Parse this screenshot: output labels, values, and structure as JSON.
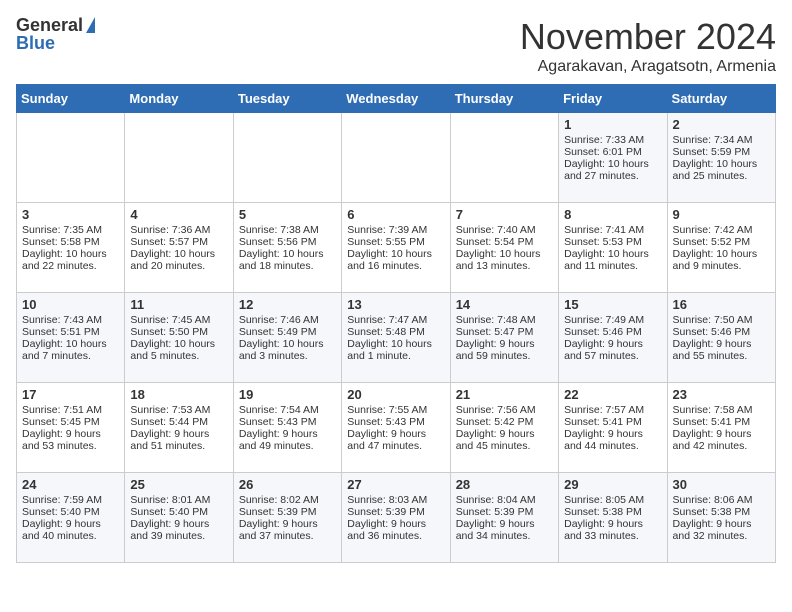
{
  "logo": {
    "line1": "General",
    "line2": "Blue"
  },
  "title": "November 2024",
  "subtitle": "Agarakavan, Aragatsotn, Armenia",
  "headers": [
    "Sunday",
    "Monday",
    "Tuesday",
    "Wednesday",
    "Thursday",
    "Friday",
    "Saturday"
  ],
  "weeks": [
    [
      {
        "day": "",
        "info": ""
      },
      {
        "day": "",
        "info": ""
      },
      {
        "day": "",
        "info": ""
      },
      {
        "day": "",
        "info": ""
      },
      {
        "day": "",
        "info": ""
      },
      {
        "day": "1",
        "info": "Sunrise: 7:33 AM\nSunset: 6:01 PM\nDaylight: 10 hours and 27 minutes."
      },
      {
        "day": "2",
        "info": "Sunrise: 7:34 AM\nSunset: 5:59 PM\nDaylight: 10 hours and 25 minutes."
      }
    ],
    [
      {
        "day": "3",
        "info": "Sunrise: 7:35 AM\nSunset: 5:58 PM\nDaylight: 10 hours and 22 minutes."
      },
      {
        "day": "4",
        "info": "Sunrise: 7:36 AM\nSunset: 5:57 PM\nDaylight: 10 hours and 20 minutes."
      },
      {
        "day": "5",
        "info": "Sunrise: 7:38 AM\nSunset: 5:56 PM\nDaylight: 10 hours and 18 minutes."
      },
      {
        "day": "6",
        "info": "Sunrise: 7:39 AM\nSunset: 5:55 PM\nDaylight: 10 hours and 16 minutes."
      },
      {
        "day": "7",
        "info": "Sunrise: 7:40 AM\nSunset: 5:54 PM\nDaylight: 10 hours and 13 minutes."
      },
      {
        "day": "8",
        "info": "Sunrise: 7:41 AM\nSunset: 5:53 PM\nDaylight: 10 hours and 11 minutes."
      },
      {
        "day": "9",
        "info": "Sunrise: 7:42 AM\nSunset: 5:52 PM\nDaylight: 10 hours and 9 minutes."
      }
    ],
    [
      {
        "day": "10",
        "info": "Sunrise: 7:43 AM\nSunset: 5:51 PM\nDaylight: 10 hours and 7 minutes."
      },
      {
        "day": "11",
        "info": "Sunrise: 7:45 AM\nSunset: 5:50 PM\nDaylight: 10 hours and 5 minutes."
      },
      {
        "day": "12",
        "info": "Sunrise: 7:46 AM\nSunset: 5:49 PM\nDaylight: 10 hours and 3 minutes."
      },
      {
        "day": "13",
        "info": "Sunrise: 7:47 AM\nSunset: 5:48 PM\nDaylight: 10 hours and 1 minute."
      },
      {
        "day": "14",
        "info": "Sunrise: 7:48 AM\nSunset: 5:47 PM\nDaylight: 9 hours and 59 minutes."
      },
      {
        "day": "15",
        "info": "Sunrise: 7:49 AM\nSunset: 5:46 PM\nDaylight: 9 hours and 57 minutes."
      },
      {
        "day": "16",
        "info": "Sunrise: 7:50 AM\nSunset: 5:46 PM\nDaylight: 9 hours and 55 minutes."
      }
    ],
    [
      {
        "day": "17",
        "info": "Sunrise: 7:51 AM\nSunset: 5:45 PM\nDaylight: 9 hours and 53 minutes."
      },
      {
        "day": "18",
        "info": "Sunrise: 7:53 AM\nSunset: 5:44 PM\nDaylight: 9 hours and 51 minutes."
      },
      {
        "day": "19",
        "info": "Sunrise: 7:54 AM\nSunset: 5:43 PM\nDaylight: 9 hours and 49 minutes."
      },
      {
        "day": "20",
        "info": "Sunrise: 7:55 AM\nSunset: 5:43 PM\nDaylight: 9 hours and 47 minutes."
      },
      {
        "day": "21",
        "info": "Sunrise: 7:56 AM\nSunset: 5:42 PM\nDaylight: 9 hours and 45 minutes."
      },
      {
        "day": "22",
        "info": "Sunrise: 7:57 AM\nSunset: 5:41 PM\nDaylight: 9 hours and 44 minutes."
      },
      {
        "day": "23",
        "info": "Sunrise: 7:58 AM\nSunset: 5:41 PM\nDaylight: 9 hours and 42 minutes."
      }
    ],
    [
      {
        "day": "24",
        "info": "Sunrise: 7:59 AM\nSunset: 5:40 PM\nDaylight: 9 hours and 40 minutes."
      },
      {
        "day": "25",
        "info": "Sunrise: 8:01 AM\nSunset: 5:40 PM\nDaylight: 9 hours and 39 minutes."
      },
      {
        "day": "26",
        "info": "Sunrise: 8:02 AM\nSunset: 5:39 PM\nDaylight: 9 hours and 37 minutes."
      },
      {
        "day": "27",
        "info": "Sunrise: 8:03 AM\nSunset: 5:39 PM\nDaylight: 9 hours and 36 minutes."
      },
      {
        "day": "28",
        "info": "Sunrise: 8:04 AM\nSunset: 5:39 PM\nDaylight: 9 hours and 34 minutes."
      },
      {
        "day": "29",
        "info": "Sunrise: 8:05 AM\nSunset: 5:38 PM\nDaylight: 9 hours and 33 minutes."
      },
      {
        "day": "30",
        "info": "Sunrise: 8:06 AM\nSunset: 5:38 PM\nDaylight: 9 hours and 32 minutes."
      }
    ]
  ]
}
